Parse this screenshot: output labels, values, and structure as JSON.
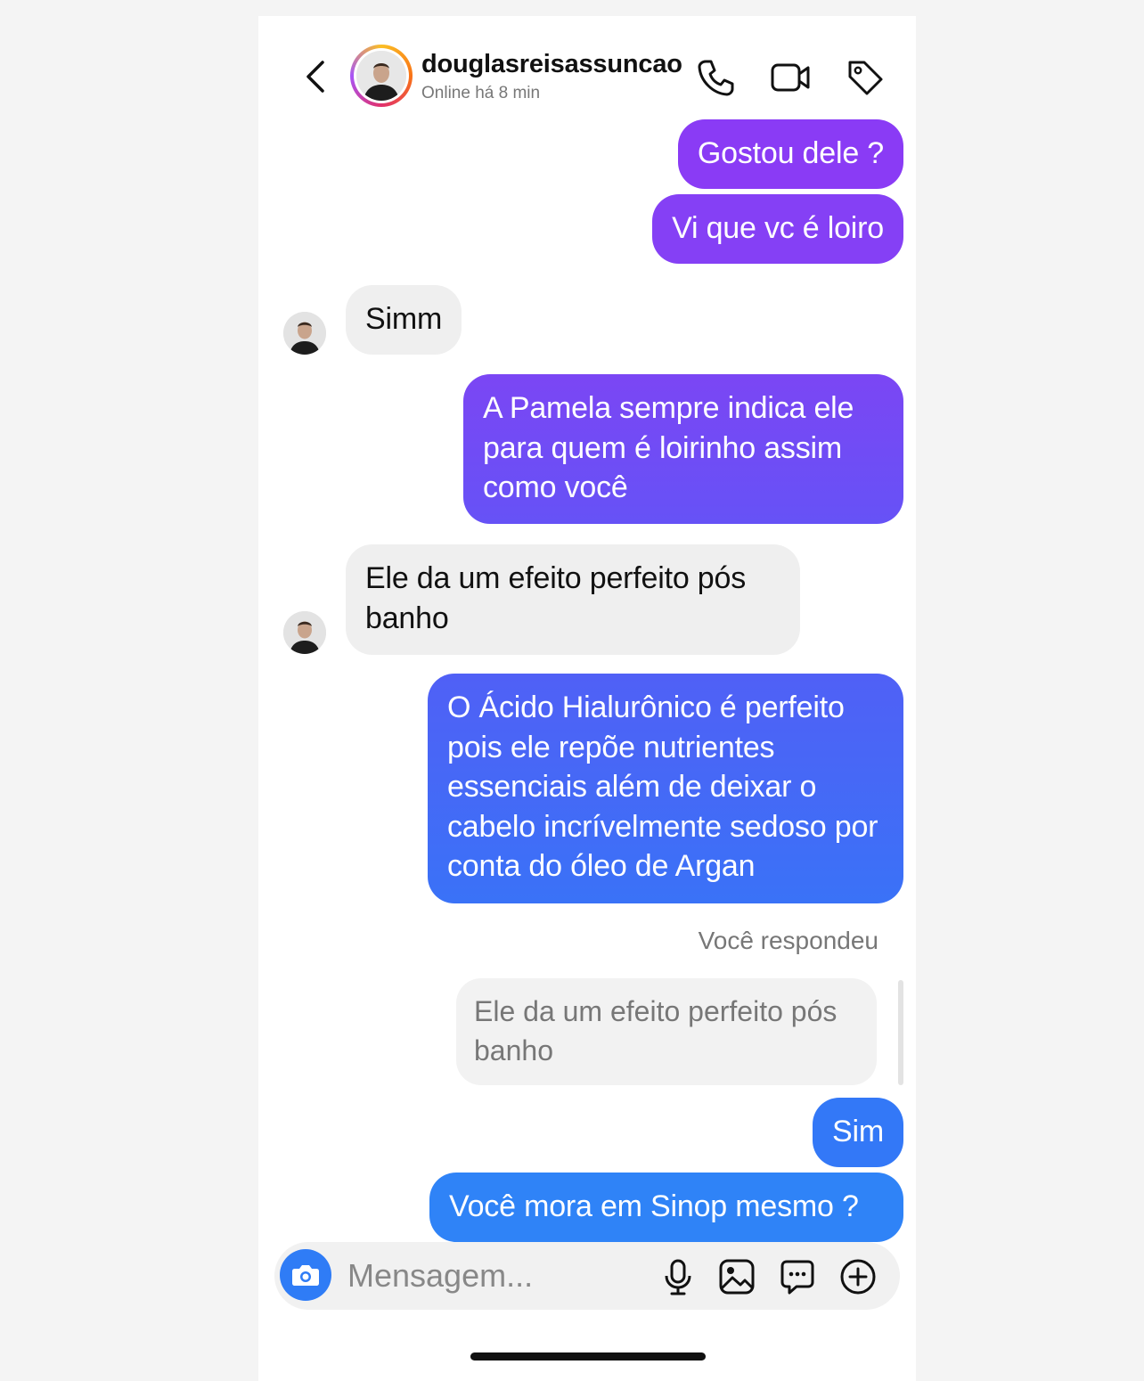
{
  "header": {
    "username": "douglasreisassuncao",
    "status": "Online há 8 min",
    "icons": [
      "back-chevron-icon",
      "phone-icon",
      "video-icon",
      "tag-icon"
    ]
  },
  "messages": [
    {
      "from": "me",
      "text": "Gostou dele ?"
    },
    {
      "from": "me",
      "text": "Vi que vc é loiro"
    },
    {
      "from": "them",
      "text": "Simm"
    },
    {
      "from": "me",
      "text": "A Pamela sempre indica ele para quem é loirinho assim como você"
    },
    {
      "from": "them",
      "text": "Ele da um efeito perfeito pós banho"
    },
    {
      "from": "me",
      "text": "O Ácido Hialurônico é perfeito pois ele repõe nutrientes essenciais além de deixar o cabelo incrívelmente sedoso por conta do óleo de Argan"
    },
    {
      "from": "me",
      "text": "Sim"
    },
    {
      "from": "me",
      "text": "Você mora em Sinop mesmo ?"
    }
  ],
  "reply": {
    "label": "Você respondeu",
    "quoted_text": "Ele da um efeito perfeito pós banho"
  },
  "composer": {
    "placeholder": "Mensagem...",
    "icons": [
      "camera-icon",
      "microphone-icon",
      "gallery-icon",
      "sticker-icon",
      "plus-icon"
    ]
  },
  "colors": {
    "outgoing_gradient_top": "#8a3cf5",
    "outgoing_gradient_bottom": "#2f83f7",
    "incoming": "#efefef",
    "camera_button": "#2f7cf6"
  }
}
